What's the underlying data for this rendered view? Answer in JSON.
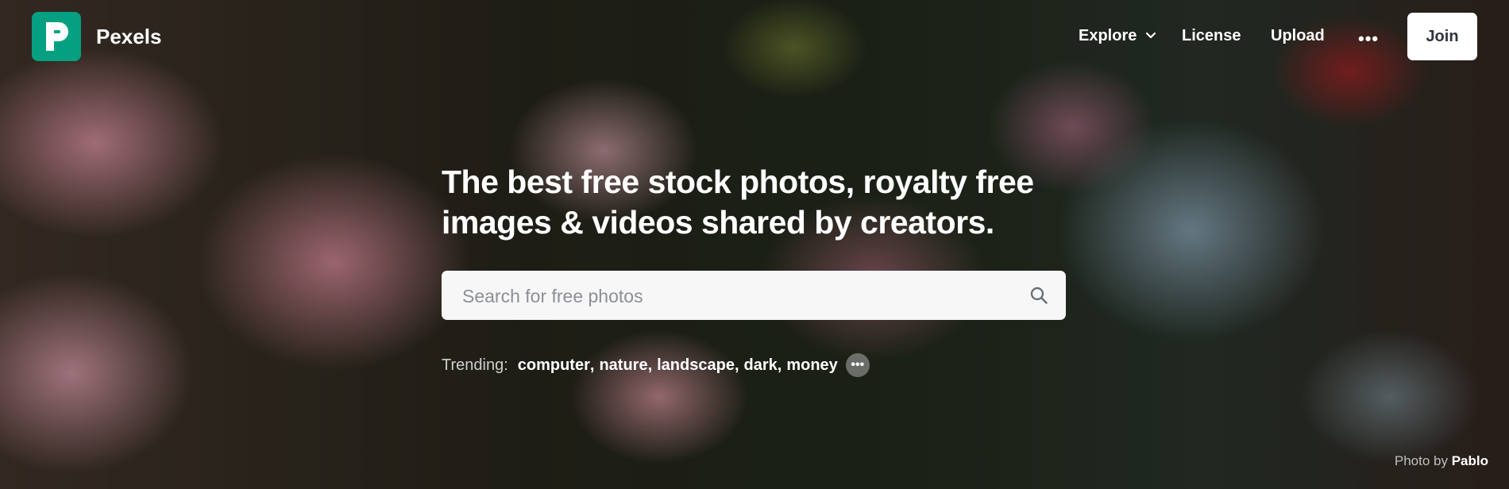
{
  "brand": {
    "name": "Pexels",
    "color": "#05A081"
  },
  "nav": {
    "explore_label": "Explore",
    "license_label": "License",
    "upload_label": "Upload",
    "more_label": "•••",
    "join_label": "Join"
  },
  "hero": {
    "headline_line1": "The best free stock photos, royalty free",
    "headline_line2": "images & videos shared by creators."
  },
  "search": {
    "placeholder": "Search for free photos",
    "value": ""
  },
  "trending": {
    "label": "Trending:",
    "items": [
      "computer",
      "nature",
      "landscape",
      "dark",
      "money"
    ],
    "more_label": "•••"
  },
  "credit": {
    "prefix": "Photo by",
    "photographer": "Pablo"
  },
  "icons": [
    "pexels-logo-icon",
    "chevron-down-icon",
    "more-horizontal-icon",
    "search-icon"
  ]
}
